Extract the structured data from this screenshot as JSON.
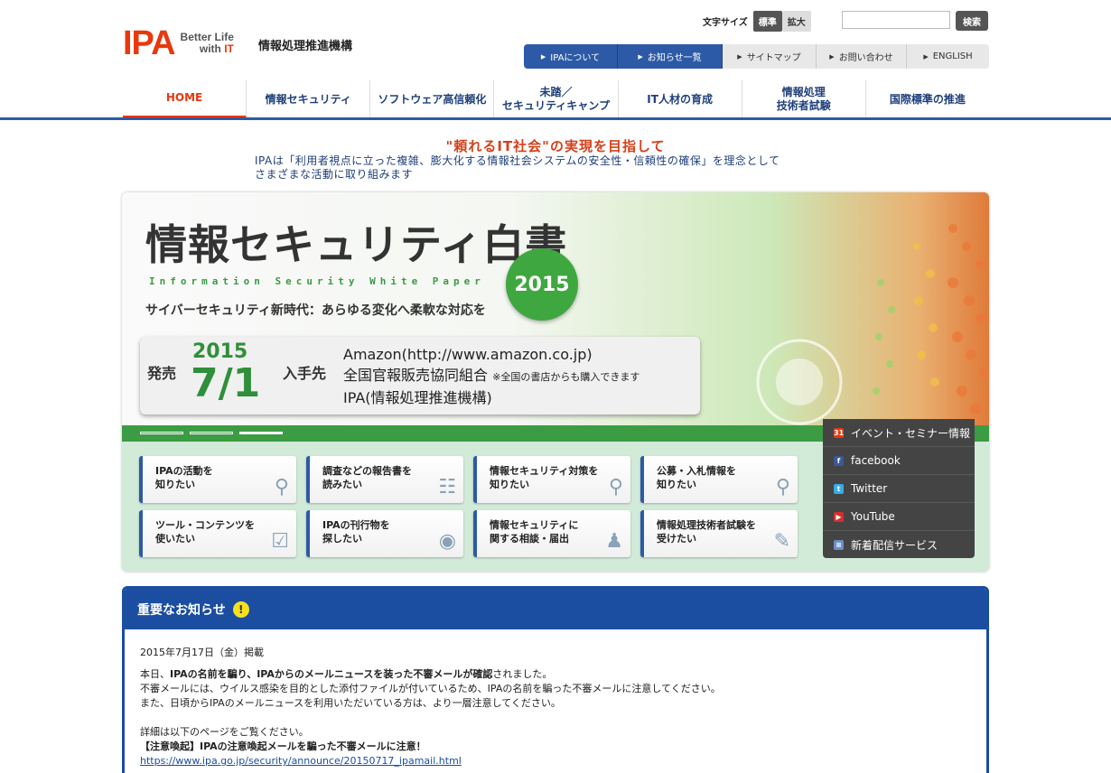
{
  "header": {
    "logo_mark": "IPA",
    "logo_tag_line1": "Better Life",
    "logo_tag_with": "with ",
    "logo_tag_it": "IT",
    "org_name": "情報処理推進機構",
    "font_size_label": "文字サイズ",
    "font_size_normal": "標準",
    "font_size_large": "拡大",
    "search_placeholder": "",
    "search_button": "検索"
  },
  "util_nav": [
    {
      "label": "IPAについて"
    },
    {
      "label": "お知らせ一覧"
    },
    {
      "label": "サイトマップ"
    },
    {
      "label": "お問い合わせ"
    },
    {
      "label": "ENGLISH"
    }
  ],
  "global_nav": [
    {
      "line1": "HOME",
      "line2": ""
    },
    {
      "line1": "情報セキュリティ",
      "line2": ""
    },
    {
      "line1": "ソフトウェア高信頼化",
      "line2": ""
    },
    {
      "line1": "未踏／",
      "line2": "セキュリティキャンプ"
    },
    {
      "line1": "IT人材の育成",
      "line2": ""
    },
    {
      "line1": "情報処理",
      "line2": "技術者試験"
    },
    {
      "line1": "国際標準の推進",
      "line2": ""
    }
  ],
  "motto": {
    "title": "\"頼れるIT社会\"の実現を目指して",
    "line1": "IPAは「利用者視点に立った複雑、膨大化する情報社会システムの安全性・信頼性の確保」を理念として",
    "line2": "さまざまな活動に取り組みます"
  },
  "banner": {
    "title": "情報セキュリティ白書",
    "subtitle": "Information Security White Paper",
    "year_badge": "2015",
    "tagline": "サイバーセキュリティ新時代：あらゆる変化へ柔軟な対応を",
    "sale_label": "発売",
    "sale_year": "2015",
    "sale_date": "7/1",
    "get_label": "入手先",
    "source1": "Amazon(http://www.amazon.co.jp)",
    "source2": "全国官報販売協同組合",
    "source2_note": "※全国の書店からも購入できます",
    "source3": "IPA(情報処理推進機構)",
    "active_slide": 3
  },
  "shortcuts": [
    {
      "line1": "IPAの活動を",
      "line2": "知りたい",
      "icon": "search-icon"
    },
    {
      "line1": "調査などの報告書を",
      "line2": "読みたい",
      "icon": "book-icon"
    },
    {
      "line1": "情報セキュリティ対策を",
      "line2": "知りたい",
      "icon": "search-icon"
    },
    {
      "line1": "公募・入札情報を",
      "line2": "知りたい",
      "icon": "search-icon"
    },
    {
      "line1": "ツール・コンテンツを",
      "line2": "使いたい",
      "icon": "check-icon"
    },
    {
      "line1": "IPAの刊行物を",
      "line2": "探したい",
      "icon": "eye-icon"
    },
    {
      "line1": "情報セキュリティに",
      "line2": "関する相談・届出",
      "icon": "person-icon"
    },
    {
      "line1": "情報処理技術者試験を",
      "line2": "受けたい",
      "icon": "pencil-icon"
    }
  ],
  "social": [
    {
      "label": "イベント・セミナー情報",
      "icon": "calendar-icon",
      "color": "#e8380d"
    },
    {
      "label": "facebook",
      "icon": "facebook-icon",
      "color": "#3b5998"
    },
    {
      "label": "Twitter",
      "icon": "twitter-icon",
      "color": "#33aee8"
    },
    {
      "label": "YouTube",
      "icon": "youtube-icon",
      "color": "#d92c2c"
    },
    {
      "label": "新着配信サービス",
      "icon": "document-icon",
      "color": "#6b8ec9"
    }
  ],
  "notice": {
    "heading": "重要なお知らせ",
    "date": "2015年7月17日（金）掲載",
    "line1_pre": "本日、",
    "line1_bold": "IPAの名前を騙り、IPAからのメールニュースを装った不審メールが確認",
    "line1_post": "されました。",
    "line2": "不審メールには、ウイルス感染を目的とした添付ファイルが付いているため、IPAの名前を騙った不審メールに注意してください。",
    "line3": "また、日頃からIPAのメールニュースを利用いただいている方は、より一層注意してください。",
    "line4": "詳細は以下のページをご覧ください。",
    "line5": "【注意喚起】IPAの注意喚起メールを騙った不審メールに注意！",
    "link": "https://www.ipa.go.jp/security/announce/20150717_ipamail.html"
  }
}
